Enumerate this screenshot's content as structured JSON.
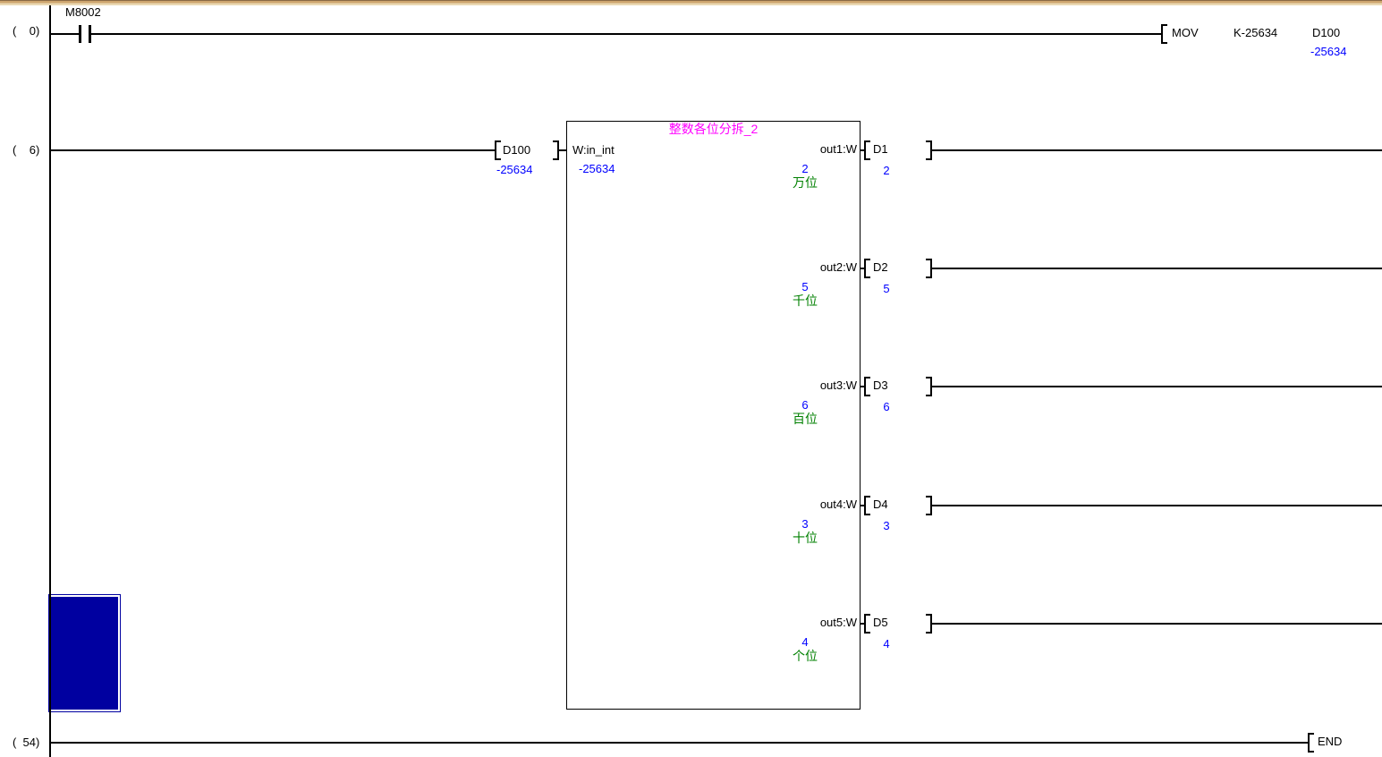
{
  "colors": {
    "wire": "#000000",
    "monitor_value_blue": "#0000ff",
    "comment_green": "#008000",
    "fb_title_magenta": "#ff00ff",
    "cursor_blue": "#0000a0",
    "frame_tan": "#cda56e"
  },
  "rung0": {
    "step": "(    0)",
    "contact": "M8002",
    "mov": {
      "opcode": "MOV",
      "source": "K-25634",
      "dest": "D100",
      "dest_value": "-25634"
    }
  },
  "rung6": {
    "step": "(    6)",
    "input_device": {
      "name": "D100",
      "value": "-25634"
    },
    "fb": {
      "title": "整数各位分拆_2",
      "input_label": "W:in_int",
      "input_value": "-25634",
      "outputs": [
        {
          "label": "out1:W",
          "value": "2",
          "comment": "万位",
          "device": "D1",
          "device_value": "2"
        },
        {
          "label": "out2:W",
          "value": "5",
          "comment": "千位",
          "device": "D2",
          "device_value": "5"
        },
        {
          "label": "out3:W",
          "value": "6",
          "comment": "百位",
          "device": "D3",
          "device_value": "6"
        },
        {
          "label": "out4:W",
          "value": "3",
          "comment": "十位",
          "device": "D4",
          "device_value": "3"
        },
        {
          "label": "out5:W",
          "value": "4",
          "comment": "个位",
          "device": "D5",
          "device_value": "4"
        }
      ]
    }
  },
  "rung54": {
    "step": "(  54)",
    "end_label": "END"
  }
}
